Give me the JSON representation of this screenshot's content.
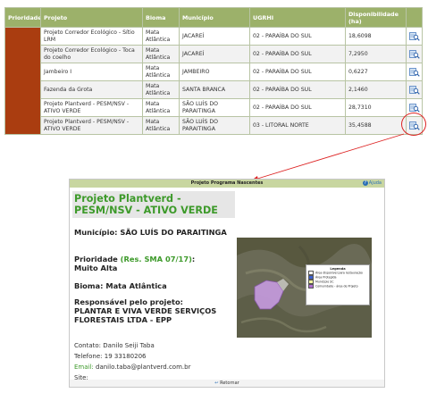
{
  "table": {
    "headers": {
      "prioridade": "Prioridade",
      "projeto": "Projeto",
      "bioma": "Bioma",
      "municipio": "Município",
      "ugrhi": "UGRHI",
      "disponibilidade": "Disponibilidade (ha)"
    },
    "priority_color": "#aa3d10",
    "action_icon": "magnify-map-icon",
    "rows": [
      {
        "projeto": "Projeto Corredor Ecológico - Sítio LRM",
        "bioma": "Mata Atlântica",
        "municipio": "JACAREÍ",
        "ugrhi": "02 - PARAÍBA DO SUL",
        "disponibilidade": "18,6098"
      },
      {
        "projeto": "Projeto Corredor Ecológico - Toca do coelho",
        "bioma": "Mata Atlântica",
        "municipio": "JACAREÍ",
        "ugrhi": "02 - PARAÍBA DO SUL",
        "disponibilidade": "7,2950"
      },
      {
        "projeto": "Jambeiro I",
        "bioma": "Mata Atlântica",
        "municipio": "JAMBEIRO",
        "ugrhi": "02 - PARAÍBA DO SUL",
        "disponibilidade": "0,6227"
      },
      {
        "projeto": "Fazenda da Grota",
        "bioma": "Mata Atlântica",
        "municipio": "SANTA BRANCA",
        "ugrhi": "02 - PARAÍBA DO SUL",
        "disponibilidade": "2,1460"
      },
      {
        "projeto": "Projeto Plantverd - PESM/NSV - ATIVO VERDE",
        "bioma": "Mata Atlântica",
        "municipio": "SÃO LUÍS DO PARAITINGA",
        "ugrhi": "02 - PARAÍBA DO SUL",
        "disponibilidade": "28,7310"
      },
      {
        "projeto": "Projeto Plantverd - PESM/NSV - ATIVO VERDE",
        "bioma": "Mata Atlântica",
        "municipio": "SÃO LUÍS DO PARAITINGA",
        "ugrhi": "03 - LITORAL NORTE",
        "disponibilidade": "35,4588"
      }
    ]
  },
  "popup": {
    "header_title": "Projeto Programa Nascentes",
    "help_label": "Ajuda",
    "help_glyph": "?",
    "project_title": "Projeto Plantverd - PESM/NSV - ATIVO VERDE",
    "municipio_label": "Município:",
    "municipio_value": "SÃO LUÍS DO PARAITINGA",
    "prioridade_label": "Prioridade",
    "prioridade_ref": "(Res. SMA 07/17)",
    "prioridade_colon": ":",
    "prioridade_value": "Muito Alta",
    "bioma_label": "Bioma:",
    "bioma_value": "Mata Atlântica",
    "responsavel_label": "Responsável pelo projeto:",
    "responsavel_value": "PLANTAR E VIVA VERDE SERVIÇOS FLORESTAIS LTDA - EPP",
    "contato_label": "Contato:",
    "contato_value": "Danilo Seiji Taba",
    "telefone_label": "Telefone:",
    "telefone_value": "19 33180206",
    "email_label": "Email:",
    "email_value": "danilo.taba@plantverd.com.br",
    "site_label": "Site:",
    "site_value": "",
    "legend": {
      "title": "Legenda",
      "items": [
        {
          "label": "Área disponível para restauração",
          "color": "#ffffff"
        },
        {
          "label": "Área Protegida",
          "color": "#3a5fd0"
        },
        {
          "label": "Município SC",
          "color": "#f4f4a0"
        },
        {
          "label": "Comunidade - área de Projeto",
          "color": "#b070d0"
        }
      ]
    },
    "return_label": "Retornar"
  }
}
